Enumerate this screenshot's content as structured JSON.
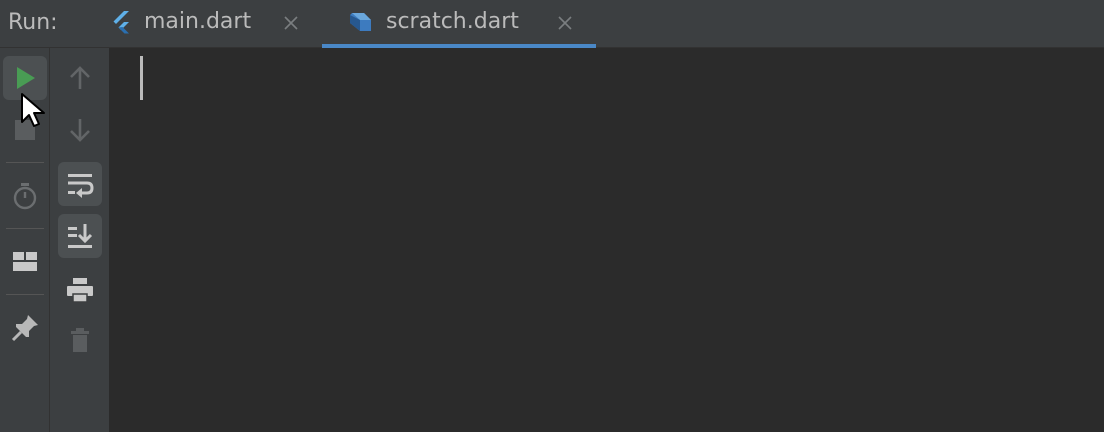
{
  "run_panel": {
    "label": "Run:",
    "tabs": [
      {
        "label": "main.dart",
        "icon": "flutter-icon",
        "active": false
      },
      {
        "label": "scratch.dart",
        "icon": "dart-icon",
        "active": true
      }
    ],
    "toolbar_primary": [
      {
        "icon": "run-icon",
        "active": true
      },
      {
        "icon": "stop-icon",
        "active": false
      },
      {
        "icon": "stopwatch-icon",
        "active": false
      },
      {
        "icon": "layout-icon",
        "active": false
      },
      {
        "icon": "pin-icon",
        "active": false
      }
    ],
    "toolbar_secondary": [
      {
        "icon": "arrow-up-icon"
      },
      {
        "icon": "arrow-down-icon"
      },
      {
        "icon": "soft-wrap-icon",
        "toggled": true
      },
      {
        "icon": "scroll-to-end-icon",
        "toggled": true
      },
      {
        "icon": "print-icon"
      },
      {
        "icon": "trash-icon"
      }
    ],
    "console_text": ""
  },
  "colors": {
    "panel_bg": "#3c3f41",
    "console_bg": "#2b2b2b",
    "text": "#bbbbbb",
    "accent": "#4a88c7",
    "run_green": "#499c54"
  }
}
